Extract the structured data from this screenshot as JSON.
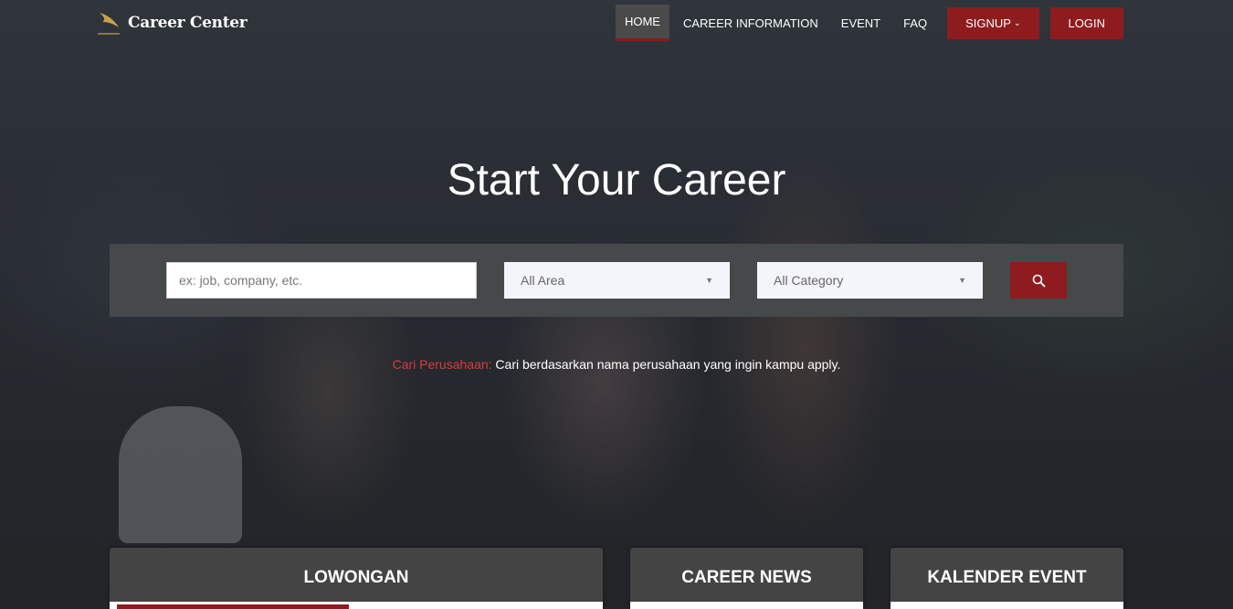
{
  "brand": {
    "name": "Career Center",
    "logo_icon": "feather-logo-icon"
  },
  "nav": {
    "items": [
      "HOME",
      "CAREER INFORMATION",
      "EVENT",
      "FAQ"
    ],
    "active": "HOME",
    "signup_label": "SIGNUP",
    "login_label": "LOGIN",
    "accent_color": "#8e1c1f"
  },
  "hero": {
    "title": "Start Your Career"
  },
  "search": {
    "keyword_placeholder": "ex: job, company, etc.",
    "keyword_value": "",
    "area_selected": "All Area",
    "category_selected": "All Category",
    "button_icon": "search-icon"
  },
  "tip": {
    "label": "Cari Perusahaan:",
    "text": "Cari berdasarkan nama perusahaan yang ingin kampu apply."
  },
  "sections": [
    {
      "title": "LOWONGAN"
    },
    {
      "title": "CAREER NEWS"
    },
    {
      "title": "KALENDER EVENT"
    }
  ]
}
